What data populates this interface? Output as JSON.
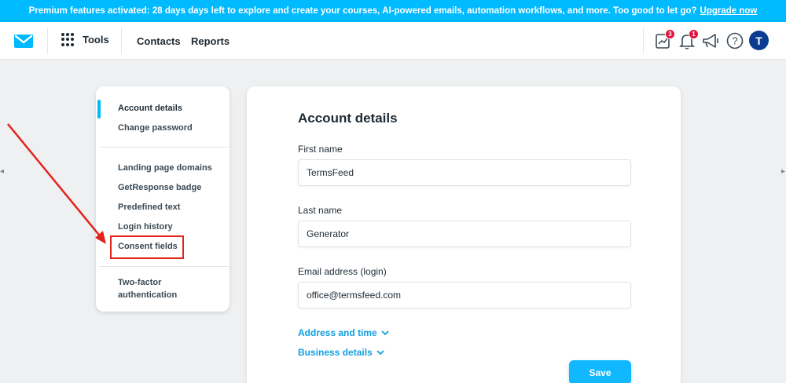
{
  "banner": {
    "text": "Premium features activated: 28 days days left to explore and create your courses, AI-powered emails, automation workflows, and more. Too good to let go?",
    "link": "Upgrade now"
  },
  "topbar": {
    "tools_label": "Tools",
    "contacts_label": "Contacts",
    "reports_label": "Reports",
    "notes_badge": "3",
    "bell_badge": "1",
    "help_glyph": "?",
    "avatar_initial": "T"
  },
  "sidebar": {
    "items": [
      "Account details",
      "Change password",
      "Landing page domains",
      "GetResponse badge",
      "Predefined text",
      "Login history",
      "Consent fields",
      "Two-factor",
      "authentication"
    ]
  },
  "form": {
    "title": "Account details",
    "first_name_label": "First name",
    "first_name_value": "TermsFeed",
    "last_name_label": "Last name",
    "last_name_value": "Generator",
    "email_label": "Email address (login)",
    "email_value": "office@termsfeed.com",
    "address_toggle": "Address and time",
    "business_toggle": "Business details",
    "save_label": "Save"
  },
  "colors": {
    "accent": "#00baff",
    "highlight": "#e2231a",
    "link": "#0fa0e0",
    "badge": "#e0143c",
    "avatar": "#0a3d91"
  }
}
